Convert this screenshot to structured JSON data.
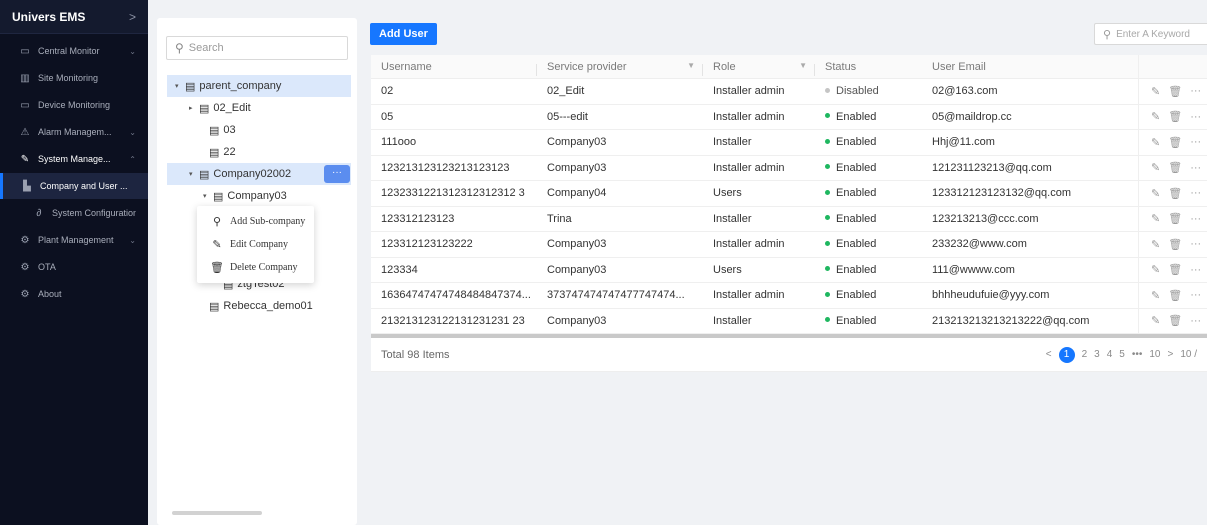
{
  "sidebar": {
    "title": "Univers EMS",
    "items": [
      {
        "label": "Central Monitor",
        "icon": "monitor-icon",
        "glyph": "▭",
        "chevron": "⌄",
        "cls": "sb-item"
      },
      {
        "label": "Site Monitoring",
        "icon": "site-icon",
        "glyph": "▥",
        "chevron": "",
        "cls": "sb-item"
      },
      {
        "label": "Device Monitoring",
        "icon": "device-icon",
        "glyph": "▭",
        "chevron": "",
        "cls": "sb-item"
      },
      {
        "label": "Alarm Managem...",
        "icon": "alarm-icon",
        "glyph": "⚠",
        "chevron": "⌄",
        "cls": "sb-item"
      },
      {
        "label": "System Manage...",
        "icon": "wrench-icon",
        "glyph": "✎",
        "chevron": "⌃",
        "cls": "sb-item open"
      },
      {
        "label": "Company and User ...",
        "icon": "building-icon",
        "glyph": "▙",
        "chevron": "",
        "cls": "sb-item sub active"
      },
      {
        "label": "System Configuration",
        "icon": "config-icon",
        "glyph": "∂",
        "chevron": "",
        "cls": "sb-item sub2"
      },
      {
        "label": "Plant Management",
        "icon": "plant-icon",
        "glyph": "⚙",
        "chevron": "⌄",
        "cls": "sb-item"
      },
      {
        "label": "OTA",
        "icon": "ota-icon",
        "glyph": "⚙",
        "chevron": "",
        "cls": "sb-item"
      },
      {
        "label": "About",
        "icon": "about-icon",
        "glyph": "⚙",
        "chevron": "",
        "cls": "sb-item"
      }
    ]
  },
  "tree": {
    "search_placeholder": "Search",
    "nodes": [
      {
        "label": "parent_company",
        "indent": 8,
        "twisty": "▾",
        "cls": "tnode selected"
      },
      {
        "label": "02_Edit",
        "indent": 22,
        "twisty": "▸",
        "cls": "tnode"
      },
      {
        "label": "03",
        "indent": 32,
        "twisty": "",
        "cls": "tnode"
      },
      {
        "label": "22",
        "indent": 32,
        "twisty": "",
        "cls": "tnode"
      },
      {
        "label": "Company02002",
        "indent": 22,
        "twisty": "▾",
        "cls": "tnode hl"
      },
      {
        "label": "Company03",
        "indent": 36,
        "twisty": "▾",
        "cls": "tnode"
      },
      {
        "label": "",
        "indent": 50,
        "twisty": "",
        "cls": "tnode"
      },
      {
        "label": "",
        "indent": 50,
        "twisty": "",
        "cls": "tnode"
      },
      {
        "label": "",
        "indent": 50,
        "twisty": "",
        "cls": "tnode"
      },
      {
        "label": "ztgTest02",
        "indent": 46,
        "twisty": "",
        "cls": "tnode"
      },
      {
        "label": "Rebecca_demo01",
        "indent": 32,
        "twisty": "",
        "cls": "tnode"
      }
    ],
    "more_label": "···",
    "context_menu": [
      {
        "label": "Add Sub-company",
        "icon": "add-sub-icon",
        "glyph": "⚲"
      },
      {
        "label": "Edit Company",
        "icon": "edit-icon",
        "glyph": "✎"
      },
      {
        "label": "Delete Company",
        "icon": "delete-icon",
        "glyph": "🗑"
      }
    ]
  },
  "toolbar": {
    "add_user_label": "Add User",
    "keyword_placeholder": "Enter A Keyword"
  },
  "table": {
    "headers": [
      "Username",
      "Service provider",
      "Role",
      "Status",
      "User Email"
    ],
    "rows": [
      {
        "username": "02",
        "provider": "02_Edit",
        "role": "Installer admin",
        "status": "Disabled",
        "email": "02@163.com"
      },
      {
        "username": "05",
        "provider": "05---edit",
        "role": "Installer admin",
        "status": "Enabled",
        "email": "05@maildrop.cc"
      },
      {
        "username": "111ooo",
        "provider": "Company03",
        "role": "Installer",
        "status": "Enabled",
        "email": "Hhj@11.com"
      },
      {
        "username": "123213123123213123123",
        "provider": "Company03",
        "role": "Installer admin",
        "status": "Enabled",
        "email": "121231123213@qq.com"
      },
      {
        "username": "1232331221312312312312 3",
        "provider": "Company04",
        "role": "Users",
        "status": "Enabled",
        "email": "123312123123132@qq.com"
      },
      {
        "username": "123312123123",
        "provider": "Trina",
        "role": "Installer",
        "status": "Enabled",
        "email": "123213213@ccc.com"
      },
      {
        "username": "123312123123222",
        "provider": "Company03",
        "role": "Installer admin",
        "status": "Enabled",
        "email": "233232@www.com"
      },
      {
        "username": "123334",
        "provider": "Company03",
        "role": "Users",
        "status": "Enabled",
        "email": "111@wwww.com"
      },
      {
        "username": "16364747474748484847374...",
        "provider": "373747474747477747474...",
        "role": "Installer admin",
        "status": "Enabled",
        "email": "bhhheudufuie@yyy.com"
      },
      {
        "username": "213213123122131231231 23",
        "provider": "Company03",
        "role": "Installer",
        "status": "Enabled",
        "email": "213213213213213222@qq.com"
      }
    ],
    "total_label": "Total 98 Items",
    "pager": {
      "prev": "<",
      "current": "1",
      "pages": [
        "2",
        "3",
        "4",
        "5",
        "•••",
        "10",
        ">",
        "10 /"
      ]
    }
  },
  "colors": {
    "accent": "#1677ff",
    "enabled": "#1fb760",
    "disabled": "#c5c5c5"
  }
}
